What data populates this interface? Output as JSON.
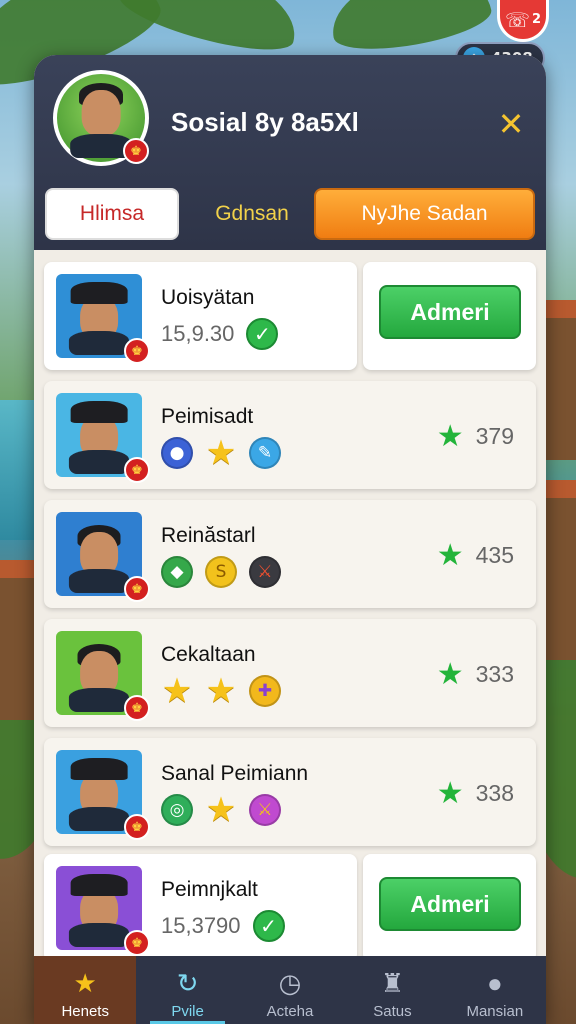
{
  "status": {
    "notifications": "2",
    "currency": "4308"
  },
  "header": {
    "title": "Sosial 8y 8a5Xl",
    "close_label": "✕"
  },
  "tabs": [
    {
      "label": "Hlimsa"
    },
    {
      "label": "Gdnsan"
    },
    {
      "label": "NyJhe Sadan"
    }
  ],
  "rows": [
    {
      "name": "Uoisyätan",
      "value": "15,9.30",
      "button": "Admeri",
      "avatar_color": "#2f8fd6",
      "hat": true
    },
    {
      "name": "Peimisadt",
      "score": "379",
      "avatar_color": "#4ab6e4",
      "hat": true,
      "icons": [
        "blue-coin-icon",
        "star-icon",
        "blue-feather-icon"
      ]
    },
    {
      "name": "Reinăstarl",
      "score": "435",
      "avatar_color": "#2f7fd0",
      "hat": false,
      "icons": [
        "green-gem-icon",
        "gold-coin-icon",
        "red-sword-icon"
      ]
    },
    {
      "name": "Cekaltaan",
      "score": "333",
      "avatar_color": "#6ac23d",
      "hat": false,
      "icons": [
        "star-icon",
        "star-icon",
        "gold-medal-icon"
      ]
    },
    {
      "name": "Sanal Peimiann",
      "score": "338",
      "avatar_color": "#3aa0e0",
      "hat": true,
      "icons": [
        "green-coin-icon",
        "star-icon",
        "purple-sword-icon"
      ]
    },
    {
      "name": "Peimnjkalt",
      "value": "15,3790",
      "button": "Admeri",
      "avatar_color": "#8a4fd6",
      "hat": true
    }
  ],
  "nav": [
    {
      "label": "Henets",
      "icon": "star-icon"
    },
    {
      "label": "Pvile",
      "icon": "refresh-icon"
    },
    {
      "label": "Acteha",
      "icon": "clock-icon"
    },
    {
      "label": "Satus",
      "icon": "trophy-icon"
    },
    {
      "label": "Mansian",
      "icon": "profile-icon"
    }
  ]
}
